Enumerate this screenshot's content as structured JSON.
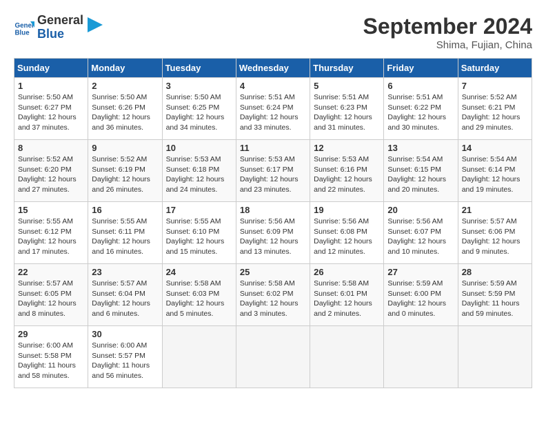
{
  "header": {
    "logo_line1": "General",
    "logo_line2": "Blue",
    "month": "September 2024",
    "location": "Shima, Fujian, China"
  },
  "days_of_week": [
    "Sunday",
    "Monday",
    "Tuesday",
    "Wednesday",
    "Thursday",
    "Friday",
    "Saturday"
  ],
  "weeks": [
    [
      {
        "day": 1,
        "info": "Sunrise: 5:50 AM\nSunset: 6:27 PM\nDaylight: 12 hours\nand 37 minutes."
      },
      {
        "day": 2,
        "info": "Sunrise: 5:50 AM\nSunset: 6:26 PM\nDaylight: 12 hours\nand 36 minutes."
      },
      {
        "day": 3,
        "info": "Sunrise: 5:50 AM\nSunset: 6:25 PM\nDaylight: 12 hours\nand 34 minutes."
      },
      {
        "day": 4,
        "info": "Sunrise: 5:51 AM\nSunset: 6:24 PM\nDaylight: 12 hours\nand 33 minutes."
      },
      {
        "day": 5,
        "info": "Sunrise: 5:51 AM\nSunset: 6:23 PM\nDaylight: 12 hours\nand 31 minutes."
      },
      {
        "day": 6,
        "info": "Sunrise: 5:51 AM\nSunset: 6:22 PM\nDaylight: 12 hours\nand 30 minutes."
      },
      {
        "day": 7,
        "info": "Sunrise: 5:52 AM\nSunset: 6:21 PM\nDaylight: 12 hours\nand 29 minutes."
      }
    ],
    [
      {
        "day": 8,
        "info": "Sunrise: 5:52 AM\nSunset: 6:20 PM\nDaylight: 12 hours\nand 27 minutes."
      },
      {
        "day": 9,
        "info": "Sunrise: 5:52 AM\nSunset: 6:19 PM\nDaylight: 12 hours\nand 26 minutes."
      },
      {
        "day": 10,
        "info": "Sunrise: 5:53 AM\nSunset: 6:18 PM\nDaylight: 12 hours\nand 24 minutes."
      },
      {
        "day": 11,
        "info": "Sunrise: 5:53 AM\nSunset: 6:17 PM\nDaylight: 12 hours\nand 23 minutes."
      },
      {
        "day": 12,
        "info": "Sunrise: 5:53 AM\nSunset: 6:16 PM\nDaylight: 12 hours\nand 22 minutes."
      },
      {
        "day": 13,
        "info": "Sunrise: 5:54 AM\nSunset: 6:15 PM\nDaylight: 12 hours\nand 20 minutes."
      },
      {
        "day": 14,
        "info": "Sunrise: 5:54 AM\nSunset: 6:14 PM\nDaylight: 12 hours\nand 19 minutes."
      }
    ],
    [
      {
        "day": 15,
        "info": "Sunrise: 5:55 AM\nSunset: 6:12 PM\nDaylight: 12 hours\nand 17 minutes."
      },
      {
        "day": 16,
        "info": "Sunrise: 5:55 AM\nSunset: 6:11 PM\nDaylight: 12 hours\nand 16 minutes."
      },
      {
        "day": 17,
        "info": "Sunrise: 5:55 AM\nSunset: 6:10 PM\nDaylight: 12 hours\nand 15 minutes."
      },
      {
        "day": 18,
        "info": "Sunrise: 5:56 AM\nSunset: 6:09 PM\nDaylight: 12 hours\nand 13 minutes."
      },
      {
        "day": 19,
        "info": "Sunrise: 5:56 AM\nSunset: 6:08 PM\nDaylight: 12 hours\nand 12 minutes."
      },
      {
        "day": 20,
        "info": "Sunrise: 5:56 AM\nSunset: 6:07 PM\nDaylight: 12 hours\nand 10 minutes."
      },
      {
        "day": 21,
        "info": "Sunrise: 5:57 AM\nSunset: 6:06 PM\nDaylight: 12 hours\nand 9 minutes."
      }
    ],
    [
      {
        "day": 22,
        "info": "Sunrise: 5:57 AM\nSunset: 6:05 PM\nDaylight: 12 hours\nand 8 minutes."
      },
      {
        "day": 23,
        "info": "Sunrise: 5:57 AM\nSunset: 6:04 PM\nDaylight: 12 hours\nand 6 minutes."
      },
      {
        "day": 24,
        "info": "Sunrise: 5:58 AM\nSunset: 6:03 PM\nDaylight: 12 hours\nand 5 minutes."
      },
      {
        "day": 25,
        "info": "Sunrise: 5:58 AM\nSunset: 6:02 PM\nDaylight: 12 hours\nand 3 minutes."
      },
      {
        "day": 26,
        "info": "Sunrise: 5:58 AM\nSunset: 6:01 PM\nDaylight: 12 hours\nand 2 minutes."
      },
      {
        "day": 27,
        "info": "Sunrise: 5:59 AM\nSunset: 6:00 PM\nDaylight: 12 hours\nand 0 minutes."
      },
      {
        "day": 28,
        "info": "Sunrise: 5:59 AM\nSunset: 5:59 PM\nDaylight: 11 hours\nand 59 minutes."
      }
    ],
    [
      {
        "day": 29,
        "info": "Sunrise: 6:00 AM\nSunset: 5:58 PM\nDaylight: 11 hours\nand 58 minutes."
      },
      {
        "day": 30,
        "info": "Sunrise: 6:00 AM\nSunset: 5:57 PM\nDaylight: 11 hours\nand 56 minutes."
      },
      {
        "day": null,
        "info": ""
      },
      {
        "day": null,
        "info": ""
      },
      {
        "day": null,
        "info": ""
      },
      {
        "day": null,
        "info": ""
      },
      {
        "day": null,
        "info": ""
      }
    ]
  ]
}
